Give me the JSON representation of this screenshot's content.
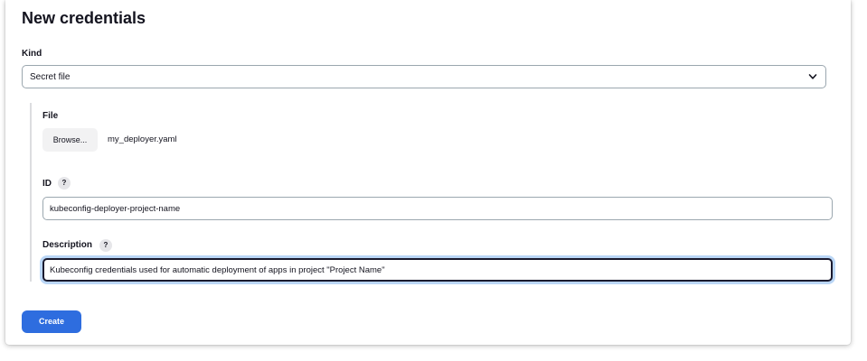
{
  "page": {
    "title": "New credentials"
  },
  "kind": {
    "label": "Kind",
    "selected": "Secret file",
    "chevron_icon": "chevron-down-icon"
  },
  "file": {
    "label": "File",
    "browse_label": "Browse...",
    "file_name": "my_deployer.yaml"
  },
  "id_field": {
    "label": "ID",
    "help": "?",
    "value": "kubeconfig-deployer-project-name"
  },
  "description": {
    "label": "Description",
    "help": "?",
    "value": "Kubeconfig credentials used for automatic deployment of apps in project \"Project Name\""
  },
  "actions": {
    "create_label": "Create"
  },
  "colors": {
    "primary_button": "#2e6ddf",
    "focus_ring": "#66a3ea",
    "border": "#9ba7af"
  }
}
